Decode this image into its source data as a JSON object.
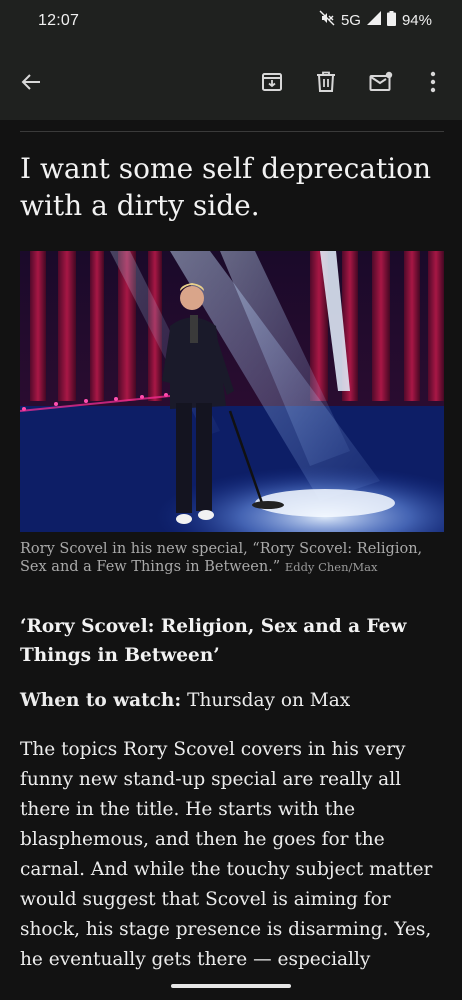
{
  "status_bar": {
    "time": "12:07",
    "network": "5G",
    "battery": "94%",
    "icons": [
      "mute-icon",
      "signal-icon",
      "battery-icon"
    ]
  },
  "toolbar": {
    "icons": [
      "back-arrow-icon",
      "archive-icon",
      "delete-icon",
      "mark-unread-icon",
      "more-vert-icon"
    ]
  },
  "article": {
    "headline": "I want some self deprecation with a dirty side.",
    "photo_caption": "Rory Scovel in his new special, “Rory Scovel: Religion, Sex and a Few Things in Between.”",
    "photo_credit": "Eddy Chen/Max",
    "subhead": "‘Rory Scovel: Religion, Sex and a Few Things in Between’",
    "when_label": "When to watch:",
    "when_value": "Thursday on Max",
    "body": "The topics Rory Scovel covers in his very funny new stand-up special are really all there in the title. He starts with the blasphemous, and then he goes for the carnal. And while the touchy subject matter would suggest that Scovel is aiming for shock, his stage presence is disarming. Yes, he eventually gets there — especially"
  },
  "colors": {
    "background": "#121212",
    "toolbar": "#1f211f",
    "text": "#ececec",
    "caption": "#a9a9a9"
  }
}
